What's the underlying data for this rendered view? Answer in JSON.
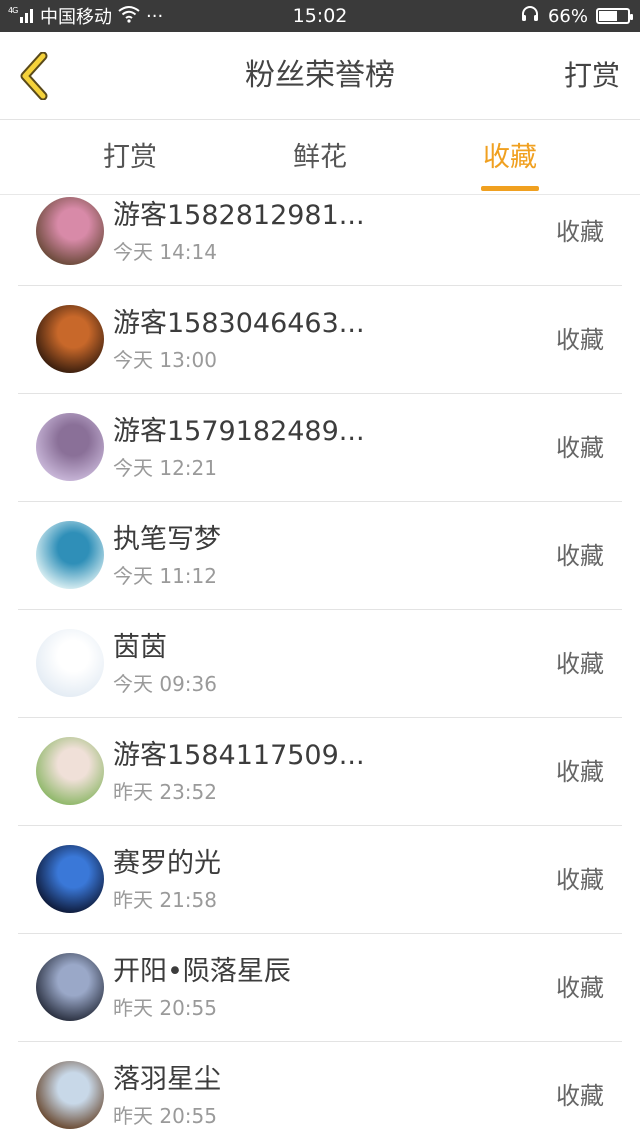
{
  "status_bar": {
    "network": "4G",
    "carrier": "中国移动",
    "more": "···",
    "time": "15:02",
    "battery": "66%",
    "battery_level": 0.66
  },
  "header": {
    "title": "粉丝荣誉榜",
    "right_action": "打赏"
  },
  "tabs": [
    {
      "label": "打赏",
      "active": false
    },
    {
      "label": "鲜花",
      "active": false
    },
    {
      "label": "收藏",
      "active": true
    }
  ],
  "list": [
    {
      "name": "游客1582812981...",
      "time": "今天 14:14",
      "action": "收藏",
      "avatar_colors": [
        "#6b4a3a",
        "#d88aa8"
      ]
    },
    {
      "name": "游客1583046463...",
      "time": "今天 13:00",
      "action": "收藏",
      "avatar_colors": [
        "#3a1e0e",
        "#c8682a"
      ]
    },
    {
      "name": "游客1579182489...",
      "time": "今天 12:21",
      "action": "收藏",
      "avatar_colors": [
        "#c8b6d8",
        "#8a7098"
      ]
    },
    {
      "name": "执笔写梦",
      "time": "今天 11:12",
      "action": "收藏",
      "avatar_colors": [
        "#d8eef2",
        "#2f8fb8"
      ]
    },
    {
      "name": "茵茵",
      "time": "今天 09:36",
      "action": "收藏",
      "avatar_colors": [
        "#e4ecf4",
        "#ffffff"
      ]
    },
    {
      "name": "游客1584117509...",
      "time": "昨天 23:52",
      "action": "收藏",
      "avatar_colors": [
        "#8fb86a",
        "#f0e0d8"
      ]
    },
    {
      "name": "赛罗的光",
      "time": "昨天 21:58",
      "action": "收藏",
      "avatar_colors": [
        "#0e1a3a",
        "#3a78d8"
      ]
    },
    {
      "name": "开阳•陨落星辰",
      "time": "昨天 20:55",
      "action": "收藏",
      "avatar_colors": [
        "#2a3040",
        "#9aa8c8"
      ]
    },
    {
      "name": "落羽星尘",
      "time": "昨天 20:55",
      "action": "收藏",
      "avatar_colors": [
        "#6a4a32",
        "#c8d8e8"
      ]
    }
  ],
  "colors": {
    "accent": "#f0a020",
    "status_bar_bg": "#3a3a3a"
  }
}
